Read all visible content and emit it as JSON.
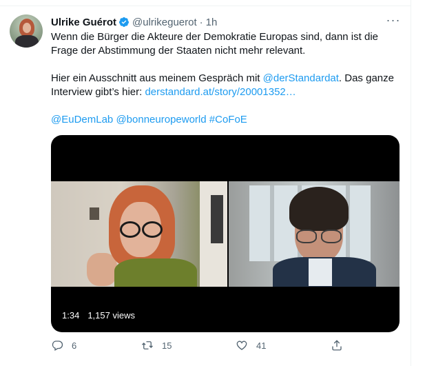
{
  "tweet": {
    "author_name": "Ulrike Guérot",
    "handle": "@ulrikeguerot",
    "separator": "·",
    "time": "1h",
    "more": "···",
    "line1": "Wenn die Bürger die Akteure der Demokratie Europas sind, dann ist die",
    "line2": "Frage der Abstimmung der Staaten nicht mehr relevant.",
    "line3_prefix": "Hier ein Ausschnitt aus meinem Gespräch mit ",
    "line3_link": "@derStandardat",
    "line3_suffix": ". Das ganze",
    "line4_prefix": "Interview gibt’s hier: ",
    "line4_link": "derstandard.at/story/20001352…",
    "mention1": "@EuDemLab",
    "mention2": "@bonneuropeworld",
    "hashtag": "#CoFoE"
  },
  "video": {
    "duration": "1:34",
    "views": "1,157 views"
  },
  "actions": {
    "reply_count": "6",
    "retweet_count": "15",
    "like_count": "41"
  },
  "icons": {
    "verified": "verified-badge-icon",
    "reply": "reply-icon",
    "retweet": "retweet-icon",
    "like": "heart-icon",
    "share": "share-icon"
  },
  "colors": {
    "link": "#1d9bf0",
    "secondary": "#536471",
    "text": "#0f1419"
  }
}
